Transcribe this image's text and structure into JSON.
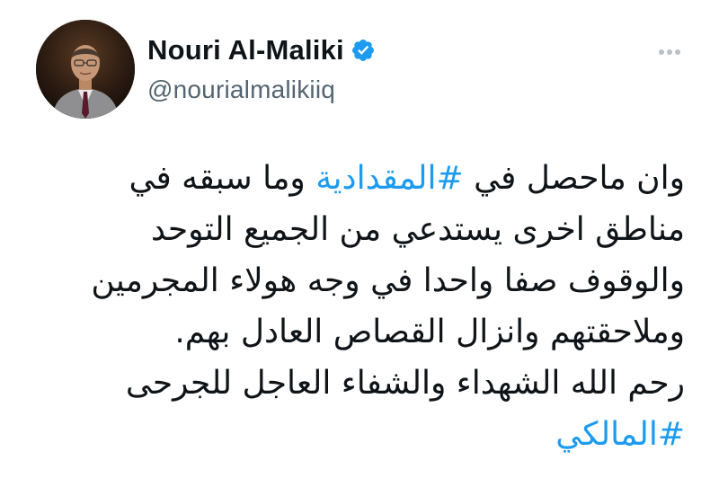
{
  "tweet": {
    "author": {
      "display_name": "Nouri Al-Maliki",
      "handle": "@nourialmalikiiq",
      "verified": true,
      "avatar_icon": "person-portrait"
    },
    "more_icon": "more-horizontal-icon",
    "text_lines": [
      {
        "pre": "وان ماحصل في ",
        "hashtag": "#المقدادية",
        "post": " وما سبقه في"
      },
      {
        "text": "مناطق اخرى يستدعي من الجميع التوحد"
      },
      {
        "text": "والوقوف صفا واحدا في وجه هولاء المجرمين"
      },
      {
        "text": "وملاحقتهم وانزال القصاص العادل بهم."
      },
      {
        "pre": "رحم الله ال",
        "post": "شهداء والشفاء العاجل للجرحى"
      },
      {
        "hashtag": "#المالكي"
      }
    ],
    "colors": {
      "text": "#0f1419",
      "secondary": "#536471",
      "accent": "#1d9bf0"
    }
  }
}
